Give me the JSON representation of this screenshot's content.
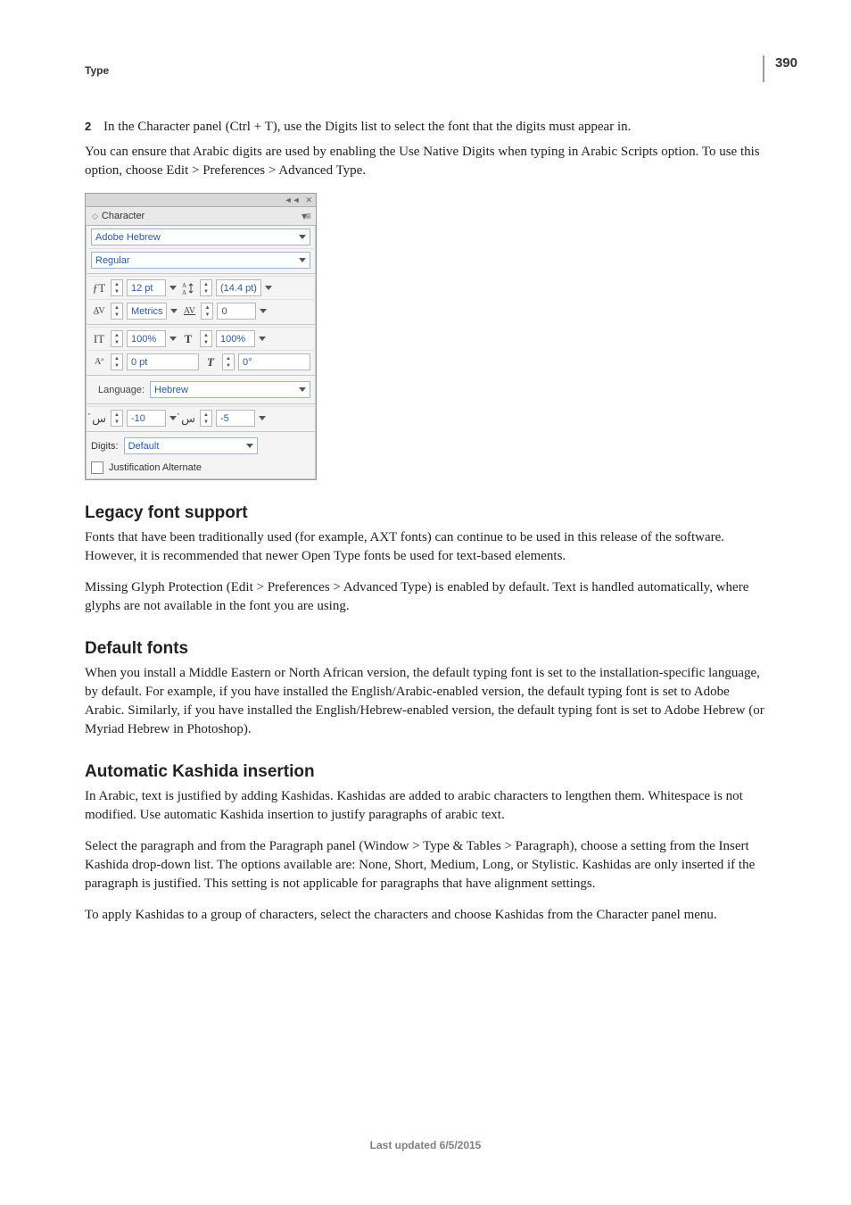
{
  "page_number": "390",
  "running_head": "Type",
  "step": {
    "num": "2",
    "text": "In the Character panel (Ctrl + T), use the Digits list to select the font that the digits must appear in."
  },
  "intro_p": "You can ensure that Arabic digits are used by enabling the Use Native Digits when typing in Arabic Scripts option. To use this option, choose Edit > Preferences > Advanced Type.",
  "char_panel": {
    "tab_label": "Character",
    "font_family": "Adobe Hebrew",
    "font_style": "Regular",
    "size_value": "12 pt",
    "leading_value": "(14.4 pt)",
    "kerning_value": "Metrics",
    "tracking_value": "0",
    "vscale_value": "100%",
    "hscale_value": "100%",
    "baseline_value": "0 pt",
    "skew_value": "0°",
    "language_label": "Language:",
    "language_value": "Hebrew",
    "diac_left_value": "-10",
    "diac_right_value": "-5",
    "digits_label": "Digits:",
    "digits_value": "Default",
    "justification_label": "Justification Alternate"
  },
  "sections": {
    "legacy": {
      "title": "Legacy font support",
      "p1": "Fonts that have been traditionally used (for example, AXT fonts) can continue to be used in this release of the software. However, it is recommended that newer Open Type fonts be used for text-based elements.",
      "p2": "Missing Glyph Protection (Edit > Preferences > Advanced Type) is enabled by default. Text is handled automatically, where glyphs are not available in the font you are using."
    },
    "defaults": {
      "title": "Default fonts",
      "p1": "When you install a Middle Eastern or North African version, the default typing font is set to the installation-specific language, by default. For example, if you have installed the English/Arabic-enabled version, the default typing font is set to Adobe Arabic. Similarly, if you have installed the English/Hebrew-enabled version, the default typing font is set to Adobe Hebrew (or Myriad Hebrew in Photoshop)."
    },
    "kashida": {
      "title": "Automatic Kashida insertion",
      "p1": "In Arabic, text is justified by adding Kashidas. Kashidas are added to arabic characters to lengthen them. Whitespace is not modified. Use automatic Kashida insertion to justify paragraphs of arabic text.",
      "p2": "Select the paragraph and from the Paragraph panel (Window > Type & Tables > Paragraph), choose a setting from the Insert Kashida drop-down list. The options available are: None, Short, Medium, Long, or Stylistic. Kashidas are only inserted if the paragraph is justified. This setting is not applicable for paragraphs that have alignment settings.",
      "p3": "To apply Kashidas to a group of characters, select the characters and choose Kashidas from the Character panel menu."
    }
  },
  "footer": "Last updated 6/5/2015"
}
